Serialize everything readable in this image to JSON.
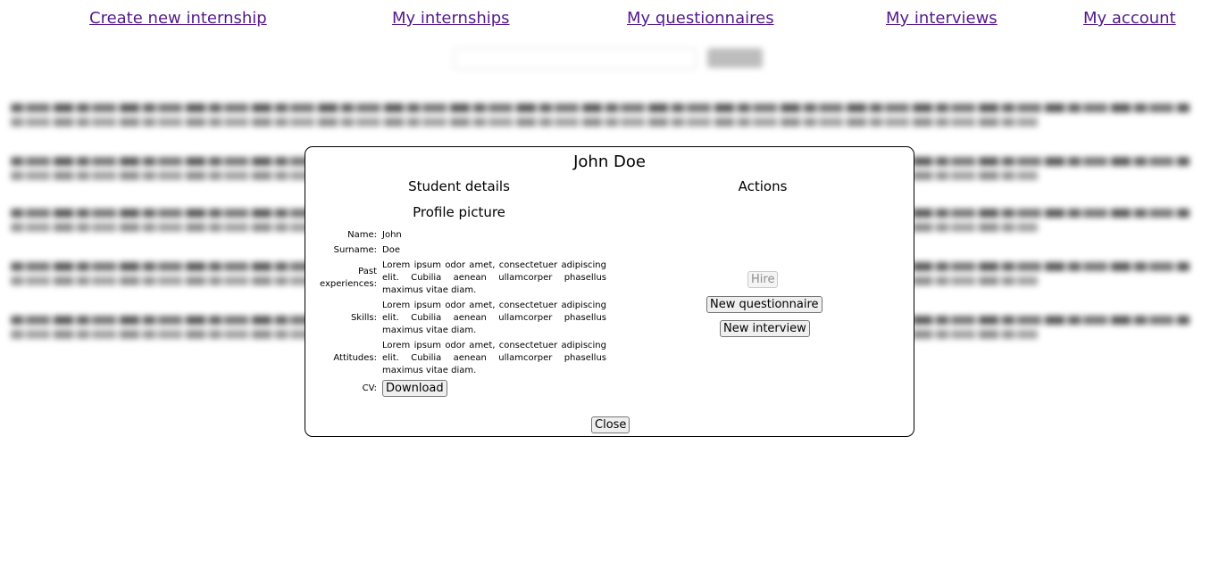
{
  "nav": {
    "create": "Create new internship",
    "internships": "My internships",
    "questionnaires": "My questionnaires",
    "interviews": "My interviews",
    "account": "My account"
  },
  "modal": {
    "title": "John Doe",
    "student_details": "Student details",
    "actions": "Actions",
    "profile_picture": "Profile picture",
    "fields": {
      "name_label": "Name:",
      "name_value": "John",
      "surname_label": "Surname:",
      "surname_value": "Doe",
      "past_label": "Past experiences:",
      "past_value": "Lorem ipsum odor amet, consectetuer adipiscing elit. Cubilia aenean ullamcorper phasellus maximus vitae diam.",
      "skills_label": "Skills:",
      "skills_value": "Lorem ipsum odor amet, consectetuer adipiscing elit. Cubilia aenean ullamcorper phasellus maximus vitae diam.",
      "attitudes_label": "Attitudes:",
      "attitudes_value": "Lorem ipsum odor amet, consectetuer adipiscing elit. Cubilia aenean ullamcorper phasellus maximus vitae diam.",
      "cv_label": "CV:",
      "download": "Download"
    },
    "buttons": {
      "hire": "Hire",
      "new_questionnaire": "New questionnaire",
      "new_interview": "New interview",
      "close": "Close"
    }
  }
}
